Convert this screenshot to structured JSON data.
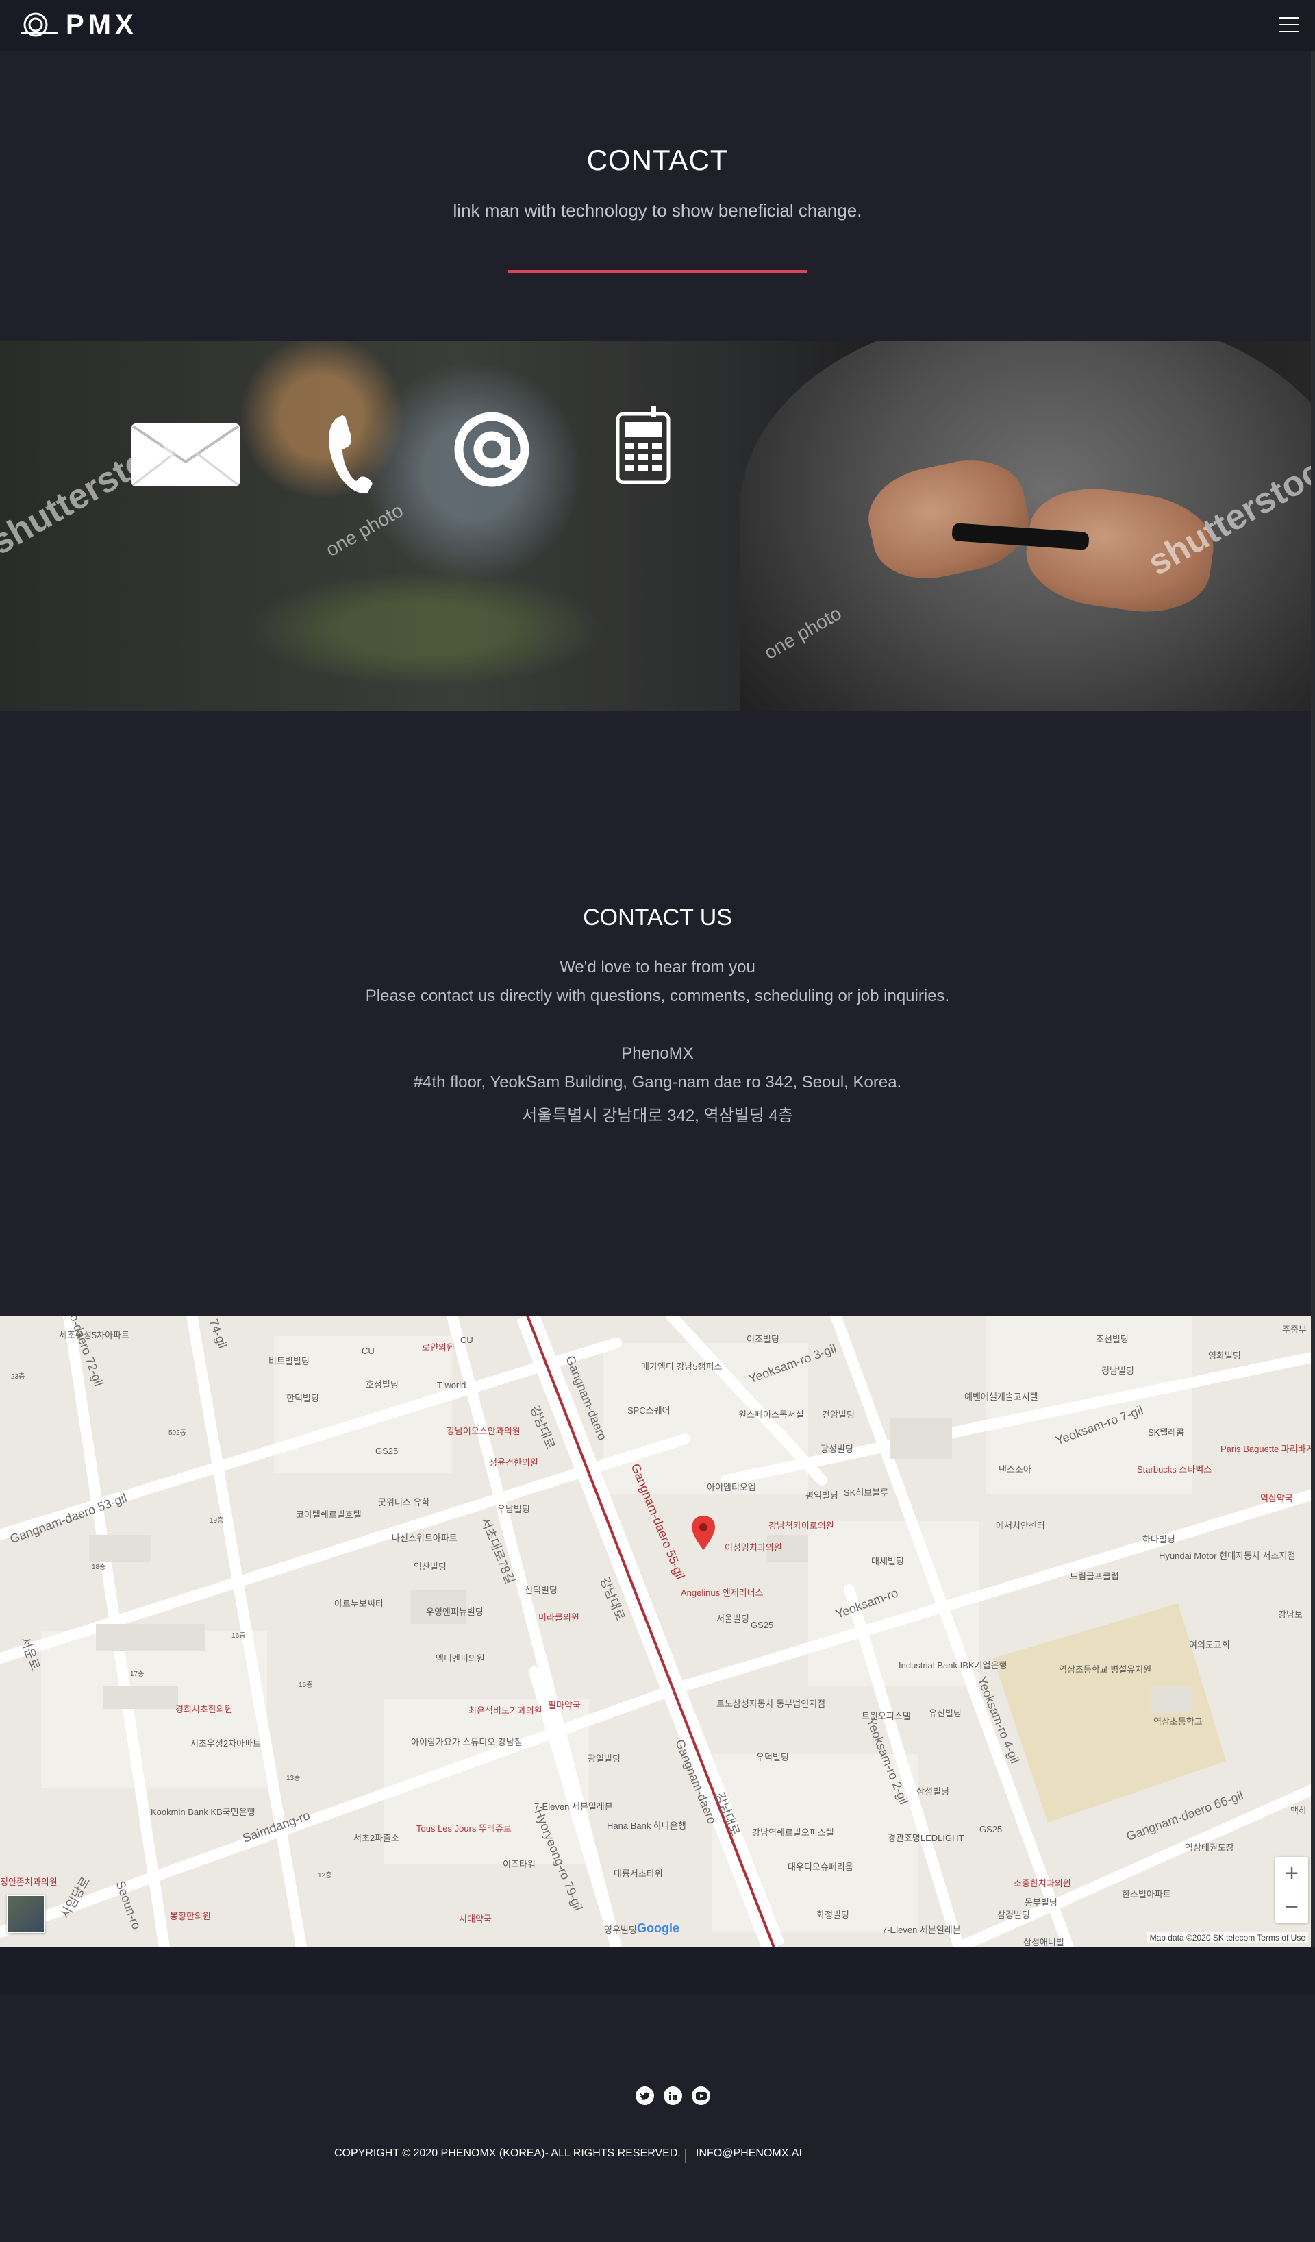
{
  "header": {
    "logo_text": "PMX"
  },
  "contact_hero": {
    "title": "CONTACT",
    "subtitle": "link man with technology to show beneficial change."
  },
  "banner": {
    "watermark_big": "shutterstock",
    "watermark_small": "one photo",
    "icons": [
      "envelope-icon",
      "telephone-icon",
      "at-sign-icon",
      "cellphone-icon"
    ]
  },
  "contact_us": {
    "title": "CONTACT US",
    "line1": "We'd love to hear from you",
    "line2": "Please contact us directly with questions, comments, scheduling or job inquiries.",
    "company": "PhenoMX",
    "address_en": "#4th floor, YeokSam Building, Gang-nam dae ro 342, Seoul, Korea.",
    "address_ko": "서울특별시 강남대로 342, 역삼빌딩 4층"
  },
  "map": {
    "labels": {
      "l1": "세조우성5차아파트",
      "l2": "비트빌빌딩",
      "l3": "CU",
      "l4": "로얀의원",
      "l5": "CU",
      "l6": "매가엠디 강남5캠퍼스",
      "l7": "이조빌딩",
      "l8": "조선빌딩",
      "l9": "영화빌딩",
      "l10": "한덕빌딩",
      "l11": "호정빌딩",
      "l12": "T world",
      "l13": "SPC스퀘어",
      "l14": "원스페이스독서실",
      "l15": "건암빌딩",
      "l16": "예벤에셀개솔고시텔",
      "l17": "경남빌딩",
      "l18": "SK텔레콤",
      "l19": "GS25",
      "l20": "강남이오스안과의원",
      "l21": "정윤건한의원",
      "l22": "광성빌딩",
      "l23": "댄스조아",
      "l24": "Starbucks 스타벅스",
      "l25": "Paris Baguette 파리바게뜨",
      "l26": "역삼약국",
      "l27": "코아텔쉐르빌호텔",
      "l28": "굿위너스 유학",
      "l29": "우남빌딩",
      "l30": "아이엠티오엠",
      "l31": "평익빌딩",
      "l32": "SK허브블루",
      "l33": "강남척카이로의원",
      "l34": "이성임치과의원",
      "l35": "에서치안센터",
      "l36": "하나빌딩",
      "l37": "Hyundai Motor 현대자동차 서초지점",
      "l38": "드림골프클럽",
      "l39": "나신스위트아파트",
      "l40": "익산빌딩",
      "l41": "아르누보씨티",
      "l42": "Angelinus 엔제리너스",
      "l43": "서울빌딩",
      "l44": "GS25",
      "l45": "대세빌딩",
      "l46": "우영엔피뉴빌딩",
      "l47": "신덕빌딩",
      "l48": "엠디엔피의원",
      "l49": "미라클의원",
      "l50": "Industrial Bank IBK기업은행",
      "l51": "역삼초등학교 병설유치원",
      "l52": "역삼초등학교",
      "l53": "여의도교회",
      "l54": "경희서초한의원",
      "l55": "서초우성2차아파트",
      "l56": "최은석비노기과의원",
      "l57": "필마약국",
      "l58": "르노삼성자동차 동부법인지점",
      "l59": "트윈오피스텔",
      "l60": "유신빌딩",
      "l61": "아이랑가요가 스튜디오 강남점",
      "l62": "광일빌딩",
      "l63": "우덕빌딩",
      "l64": "삼성빌딩",
      "l65": "Kookmin Bank KB국민은행",
      "l66": "7-Eleven 세븐일레븐",
      "l67": "Hana Bank 하나은행",
      "l68": "Tous Les Jours 뚜레쥬르",
      "l69": "서초2파출소",
      "l70": "이즈타워",
      "l71": "강남역쉐르빌오피스텔",
      "l72": "경관조명LEDLIGHT",
      "l73": "GS25",
      "l74": "역삼태권도장",
      "l75": "대우디오슈페리움",
      "l76": "대륭서초타워",
      "l77": "시대약국",
      "l78": "봉황한의원",
      "l79": "화정빌딩",
      "l80": "7-Eleven 세븐일레븐",
      "l81": "소중한치과의원",
      "l82": "동부빌딩",
      "l83": "삼경빌딩",
      "l84": "한스빌아파트",
      "l85": "삼성애니빌",
      "l86": "영우빌딩",
      "l87": "주중부",
      "l88": "맥하",
      "l89": "강남보",
      "l90": "정안존치과의원",
      "l91": "23층",
      "l92": "19층",
      "l93": "16층",
      "l94": "17층",
      "l95": "15층",
      "l96": "13층",
      "l97": "12층",
      "l98": "502동",
      "l99": "18층"
    },
    "roads": {
      "r1": "Gangnam-daero",
      "r2": "강남대로",
      "r3": "Yeoksam-ro 3-gil",
      "r4": "Yeoksam-ro 7-gil",
      "r5": "Yeoksam-ro",
      "r6": "Yeoksam-ro 2-gil",
      "r7": "Yeoksam-ro 4-gil",
      "r8": "Gangnam-daero 66-gil",
      "r9": "Gangnam-daero 53-gil",
      "r10": "Saimdang-ro",
      "r11": "Hyoryeong-ro 79-gil",
      "r12": "사임당로",
      "r13": "Seoun-ro",
      "r14": "서운로",
      "r15": "서초대로78길",
      "r16": "Gangnam-daero",
      "r17": "강남대로",
      "r18": "o-daero 72-gil",
      "r19": "74-gil",
      "r20": "강남대로",
      "r21": "Gangnam-daero 55-gil"
    },
    "google_logo": "Google",
    "credit": "Map data ©2020 SK telecom    Terms of Use",
    "zoom_in": "+",
    "zoom_out": "−"
  },
  "footer": {
    "copyright": "COPYRIGHT © 2020 PHENOMX (KOREA)- ALL RIGHTS RESERVED.",
    "email": "INFO@PHENOMX.AI",
    "socials": [
      "twitter-icon",
      "linkedin-icon",
      "youtube-icon"
    ]
  }
}
